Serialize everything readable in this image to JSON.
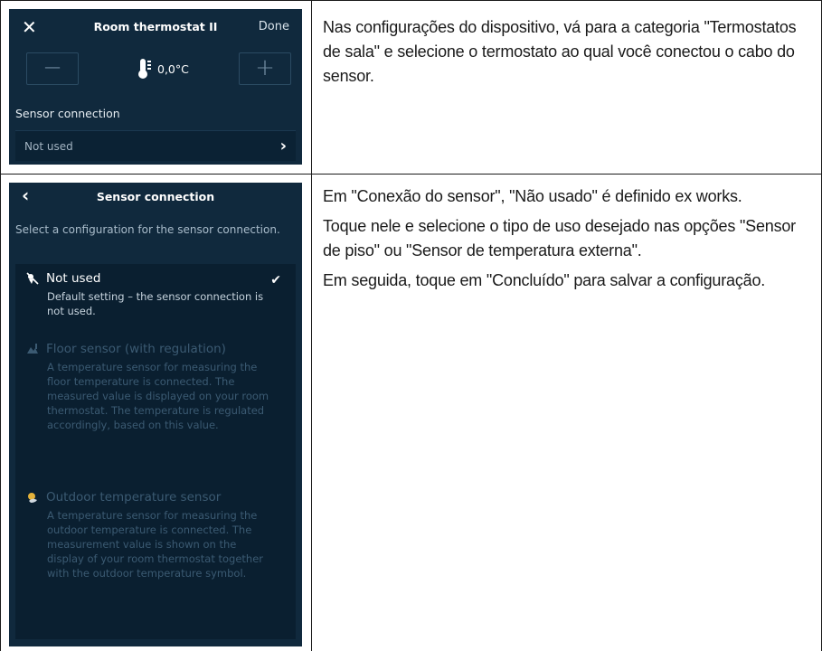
{
  "screen1": {
    "close_icon": "close-icon",
    "title": "Room thermostat II",
    "done_label": "Done",
    "minus_label": "−",
    "plus_label": "+",
    "temperature": "0,0°C",
    "section_label": "Sensor connection",
    "row_value": "Not used",
    "row_chevron": "›"
  },
  "screen2": {
    "back_icon": "back-icon",
    "title": "Sensor connection",
    "intro": "Select a configuration for the sensor connection.",
    "options": [
      {
        "label": "Not used",
        "description": "Default setting – the sensor connection is not used.",
        "selected": true
      },
      {
        "label": "Floor sensor (with regulation)",
        "description": "A temperature sensor for measuring the floor temperature is connected. The measured value is displayed on your room thermostat. The temperature is regulated accordingly, based on this value.",
        "selected": false
      },
      {
        "label": "Outdoor temperature sensor",
        "description": "A temperature sensor for measuring the outdoor temperature is connected. The measurement value is shown on the display of your room thermostat together with the outdoor temperature symbol.",
        "selected": false
      }
    ],
    "checkmark": "✔"
  },
  "right_column": {
    "row1": "Nas configurações do dispositivo, vá para a categoria \"Termostatos de sala\" e selecione o termostato ao qual você conectou o cabo do sensor.",
    "row2_p1": "Em \"Conexão do sensor\", \"Não usado\" é definido ex works.",
    "row2_p2": "Toque nele e selecione o tipo de uso desejado nas opções \"Sensor de piso\" ou \"Sensor de temperatura externa\".",
    "row2_p3": "Em seguida, toque em \"Concluído\" para salvar a configuração."
  },
  "colors": {
    "screen_bg": "#10293d",
    "panel_bg": "#0a1f30",
    "inactive_text": "#3b5a72",
    "border": "#1a1a1a"
  }
}
